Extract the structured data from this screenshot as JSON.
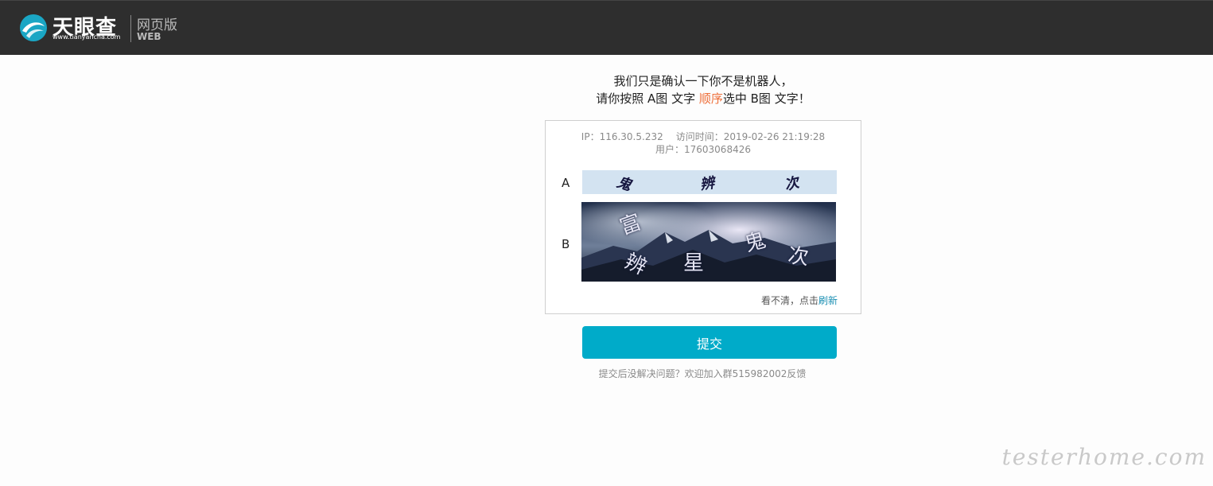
{
  "header": {
    "brand_name": "天眼查",
    "brand_domain": "www.tianyancha.com",
    "edition_zh": "网页版",
    "edition_en": "WEB",
    "accent_color": "#1aa6c4"
  },
  "prompt": {
    "line1": "我们只是确认一下你不是机器人，",
    "line2_before": "请你按照 A图 文字 ",
    "line2_highlight": "顺序",
    "line2_after": "选中 B图 文字！",
    "highlight_color": "#ee6f3a"
  },
  "captcha": {
    "ip_label": "IP：116.30.5.232",
    "visit_time": "访问时间：2019-02-26 21:19:28",
    "user": "用户：17603068426",
    "label_a": "A",
    "label_b": "B",
    "a_chars": [
      "鬼",
      "辨",
      "次"
    ],
    "b_chars": [
      "富",
      "辨",
      "星",
      "鬼",
      "次"
    ],
    "refresh_text": "看不清，点击",
    "refresh_link": "刷新"
  },
  "submit_label": "提交",
  "help_text": "提交后没解决问题？欢迎加入群515982002反馈",
  "watermark": "testerhome.com",
  "colors": {
    "topbar": "#2e2e2e",
    "button": "#00abc9",
    "link": "#1a8fb3"
  }
}
